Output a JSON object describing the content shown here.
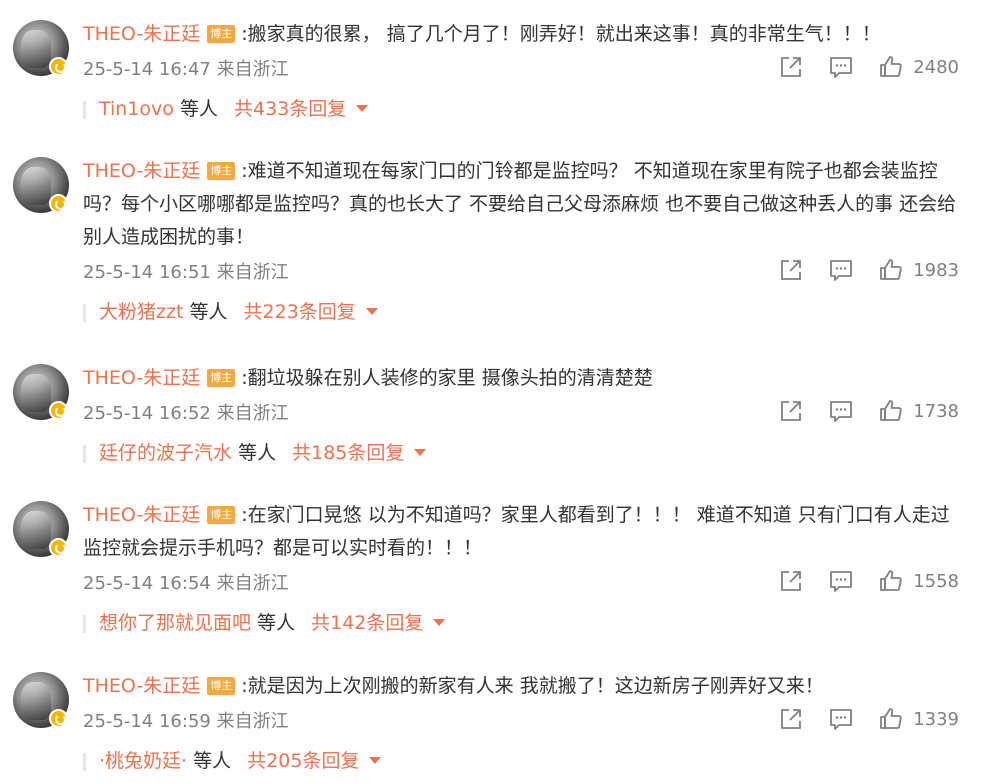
{
  "colors": {
    "username": "#eb7350",
    "host_tag_bg": "#f8a83d",
    "meta_text": "#808080",
    "body_text": "#333333",
    "verify_badge": "#f7b500"
  },
  "comments": [
    {
      "username": "THEO-朱正廷",
      "tag": "博主",
      "text": ":搬家真的很累， 搞了几个月了！刚弄好！就出来这事！真的非常生气！！！",
      "time": "25-5-14 16:47 来自浙江",
      "likes": "2480",
      "reply_who": "Tin1ovo",
      "reply_suffix": "等人",
      "reply_total": "共433条回复"
    },
    {
      "username": "THEO-朱正廷",
      "tag": "博主",
      "text": ":难道不知道现在每家门口的门铃都是监控吗？ 不知道现在家里有院子也都会装监控吗？每个小区哪哪都是监控吗？真的也长大了 不要给自己父母添麻烦 也不要自己做这种丢人的事 还会给别人造成困扰的事！",
      "time": "25-5-14 16:51 来自浙江",
      "likes": "1983",
      "reply_who": "大粉猪zzt",
      "reply_suffix": "等人",
      "reply_total": "共223条回复"
    },
    {
      "username": "THEO-朱正廷",
      "tag": "博主",
      "text": ":翻垃圾躲在别人装修的家里 摄像头拍的清清楚楚",
      "time": "25-5-14 16:52 来自浙江",
      "likes": "1738",
      "reply_who": "廷仔的波子汽水",
      "reply_suffix": "等人",
      "reply_total": "共185条回复"
    },
    {
      "username": "THEO-朱正廷",
      "tag": "博主",
      "text": ":在家门口晃悠 以为不知道吗？家里人都看到了！！！ 难道不知道 只有门口有人走过监控就会提示手机吗？都是可以实时看的！！！",
      "time": "25-5-14 16:54 来自浙江",
      "likes": "1558",
      "reply_who": "想你了那就见面吧",
      "reply_suffix": "等人",
      "reply_total": "共142条回复"
    },
    {
      "username": "THEO-朱正廷",
      "tag": "博主",
      "text": ":就是因为上次刚搬的新家有人来 我就搬了！这边新房子刚弄好又来！",
      "time": "25-5-14 16:59 来自浙江",
      "likes": "1339",
      "reply_who": "·桃兔奶廷·",
      "reply_suffix": "等人",
      "reply_total": "共205条回复"
    }
  ],
  "icons": {
    "share": "share-icon",
    "comment": "comment-icon",
    "like": "thumbs-up-icon",
    "expand": "chevron-down-icon"
  }
}
